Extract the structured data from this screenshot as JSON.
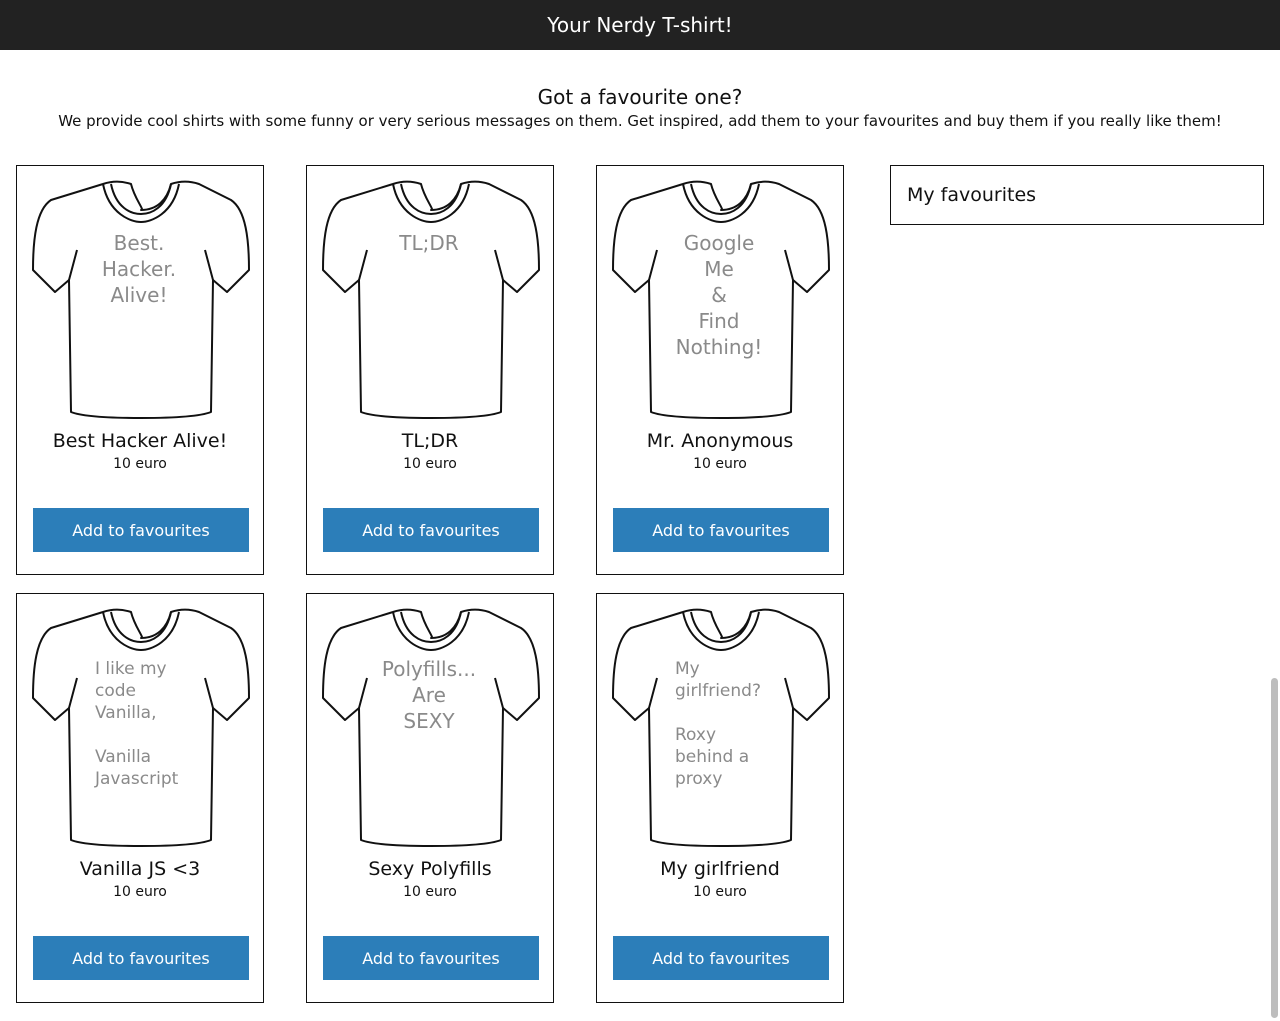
{
  "header": {
    "title": "Your Nerdy T-shirt!"
  },
  "intro": {
    "heading": "Got a favourite one?",
    "text": "We provide cool shirts with some funny or very serious messages on them. Get inspired, add them to your favourites and buy them if you really like them!"
  },
  "button_label": "Add to favourites",
  "products": [
    {
      "name": "Best Hacker Alive!",
      "price": "10 euro",
      "shirt_lines": [
        "Best.",
        "Hacker.",
        "Alive!"
      ]
    },
    {
      "name": "TL;DR",
      "price": "10 euro",
      "shirt_lines": [
        "TL;DR"
      ]
    },
    {
      "name": "Mr. Anonymous",
      "price": "10 euro",
      "shirt_lines": [
        "Google",
        "Me",
        "&",
        "Find",
        "Nothing!"
      ]
    },
    {
      "name": "Vanilla JS <3",
      "price": "10 euro",
      "shirt_lines": [
        "I like my",
        "code",
        "Vanilla,",
        "",
        "Vanilla",
        "Javascript"
      ]
    },
    {
      "name": "Sexy Polyfills",
      "price": "10 euro",
      "shirt_lines": [
        "Polyfills...",
        "Are",
        "SEXY"
      ]
    },
    {
      "name": "My girlfriend",
      "price": "10 euro",
      "shirt_lines": [
        "My",
        "girlfriend?",
        "",
        "Roxy",
        "behind a",
        "proxy"
      ]
    }
  ],
  "favourites": {
    "title": "My favourites"
  },
  "icons": {
    "shirt": "tshirt-outline-icon"
  }
}
